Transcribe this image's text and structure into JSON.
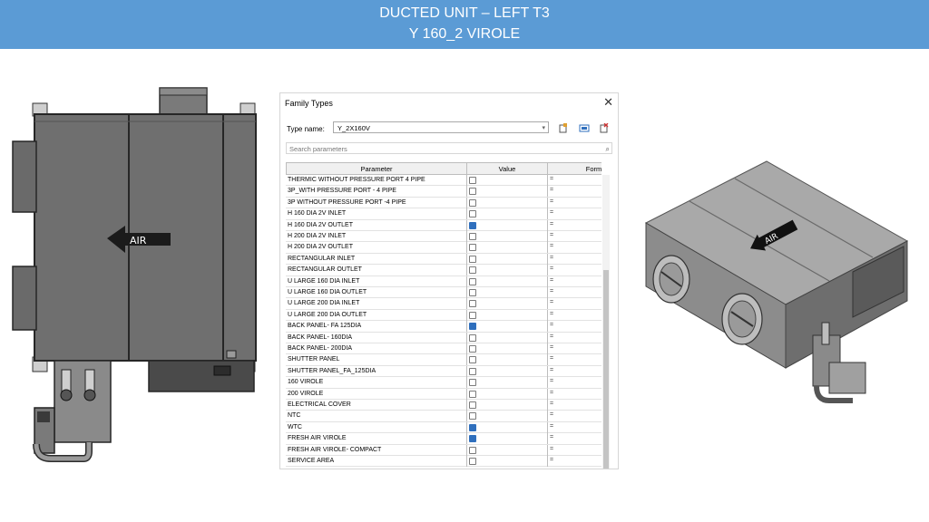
{
  "header": {
    "line1": "DUCTED UNIT – LEFT T3",
    "line2": "Y 160_2 VIROLE"
  },
  "left_drawing": {
    "air_label": "AIR"
  },
  "right_drawing": {
    "air_label": "AIR"
  },
  "dialog": {
    "title": "Family Types",
    "close_icon": "close-icon",
    "type_name_label": "Type name:",
    "type_name_value": "Y_2X160V",
    "search_placeholder": "Search parameters",
    "columns": {
      "parameter": "Parameter",
      "value": "Value",
      "formula": "Formula"
    },
    "rows": [
      {
        "name": "THERMIC WITHOUT PRESSURE PORT  4 PIPE",
        "checked": false,
        "formula": "="
      },
      {
        "name": "3P_WITH PRESSURE PORT - 4 PIPE",
        "checked": false,
        "formula": "="
      },
      {
        "name": "3P WITHOUT PRESSURE PORT -4  PIPE",
        "checked": false,
        "formula": "="
      },
      {
        "name": "H 160 DIA 2V INLET",
        "checked": false,
        "formula": "="
      },
      {
        "name": "H 160 DIA 2V OUTLET",
        "checked": true,
        "formula": "="
      },
      {
        "name": "H 200 DIA 2V INLET",
        "checked": false,
        "formula": "="
      },
      {
        "name": "H 200 DIA 2V OUTLET",
        "checked": false,
        "formula": "="
      },
      {
        "name": "RECTANGULAR INLET",
        "checked": false,
        "formula": "="
      },
      {
        "name": "RECTANGULAR  OUTLET",
        "checked": false,
        "formula": "="
      },
      {
        "name": "U LARGE 160 DIA INLET",
        "checked": false,
        "formula": "="
      },
      {
        "name": "U LARGE 160 DIA OUTLET",
        "checked": false,
        "formula": "="
      },
      {
        "name": "U LARGE 200 DIA INLET",
        "checked": false,
        "formula": "="
      },
      {
        "name": "U LARGE 200 DIA OUTLET",
        "checked": false,
        "formula": "="
      },
      {
        "name": "BACK PANEL- FA 125DIA",
        "checked": true,
        "formula": "="
      },
      {
        "name": "BACK PANEL- 160DIA",
        "checked": false,
        "formula": "="
      },
      {
        "name": "BACK PANEL- 200DIA",
        "checked": false,
        "formula": "="
      },
      {
        "name": "SHUTTER PANEL",
        "checked": false,
        "formula": "="
      },
      {
        "name": "SHUTTER PANEL_FA_125DIA",
        "checked": false,
        "formula": "="
      },
      {
        "name": "160 VIROLE",
        "checked": false,
        "formula": "="
      },
      {
        "name": "200 VIROLE",
        "checked": false,
        "formula": "="
      },
      {
        "name": "ELECTRICAL COVER",
        "checked": false,
        "formula": "="
      },
      {
        "name": "NTC",
        "checked": false,
        "formula": "="
      },
      {
        "name": "WTC",
        "checked": true,
        "formula": "="
      },
      {
        "name": "FRESH AIR VIROLE",
        "checked": true,
        "formula": "="
      },
      {
        "name": "FRESH AIR VIROLE- COMPACT",
        "checked": false,
        "formula": "="
      },
      {
        "name": "SERVICE AREA",
        "checked": false,
        "formula": "="
      }
    ]
  },
  "colors": {
    "header_bg": "#5b9bd5",
    "checkbox_on": "#2f6fbd",
    "unit_gray": "#6f6f6f"
  }
}
